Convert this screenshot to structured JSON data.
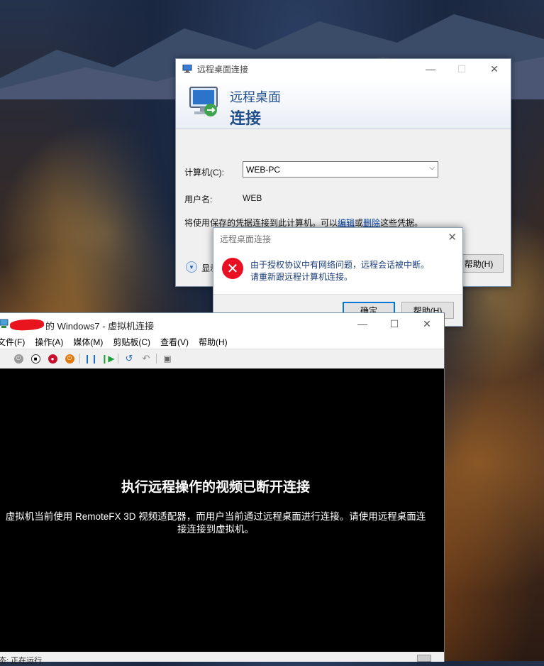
{
  "rdp_window": {
    "title": "远程桌面连接",
    "banner_line1": "远程桌面",
    "banner_line2": "连接",
    "computer_label": "计算机(C):",
    "computer_value": "WEB-PC",
    "username_label": "用户名:",
    "username_value": "WEB",
    "saved_cred_text_prefix": "将使用保存的凭据连接到此计算机。可以",
    "edit_link": "编辑",
    "or_text": "或",
    "delete_link": "删除",
    "saved_cred_text_suffix": "这些凭据。",
    "show_options_label": "显示",
    "help_button": "帮助(H)"
  },
  "error_dialog": {
    "title": "远程桌面连接",
    "message_line1": "由于授权协议中有网络问题，远程会话被中断。",
    "message_line2": "请重新跟远程计算机连接。",
    "ok_button": "确定",
    "help_button": "帮助(H)"
  },
  "vm_window": {
    "title_suffix": "的 Windows7 - 虚拟机连接",
    "menus": [
      "文件(F)",
      "操作(A)",
      "媒体(M)",
      "剪贴板(C)",
      "查看(V)",
      "帮助(H)"
    ],
    "screen_heading": "执行远程操作的视频已断开连接",
    "screen_message_line1": "虚拟机当前使用 RemoteFX 3D 视频适配器，而用户当前通过远程桌面进行连接。请使用远程桌面连",
    "screen_message_line2": "接连接到虚拟机。",
    "status_text": "态: 正在运行"
  },
  "colors": {
    "title_blue": "#1f4e8c",
    "error_red": "#e81123",
    "link_blue": "#0645ad",
    "focus_blue": "#0078d7"
  }
}
